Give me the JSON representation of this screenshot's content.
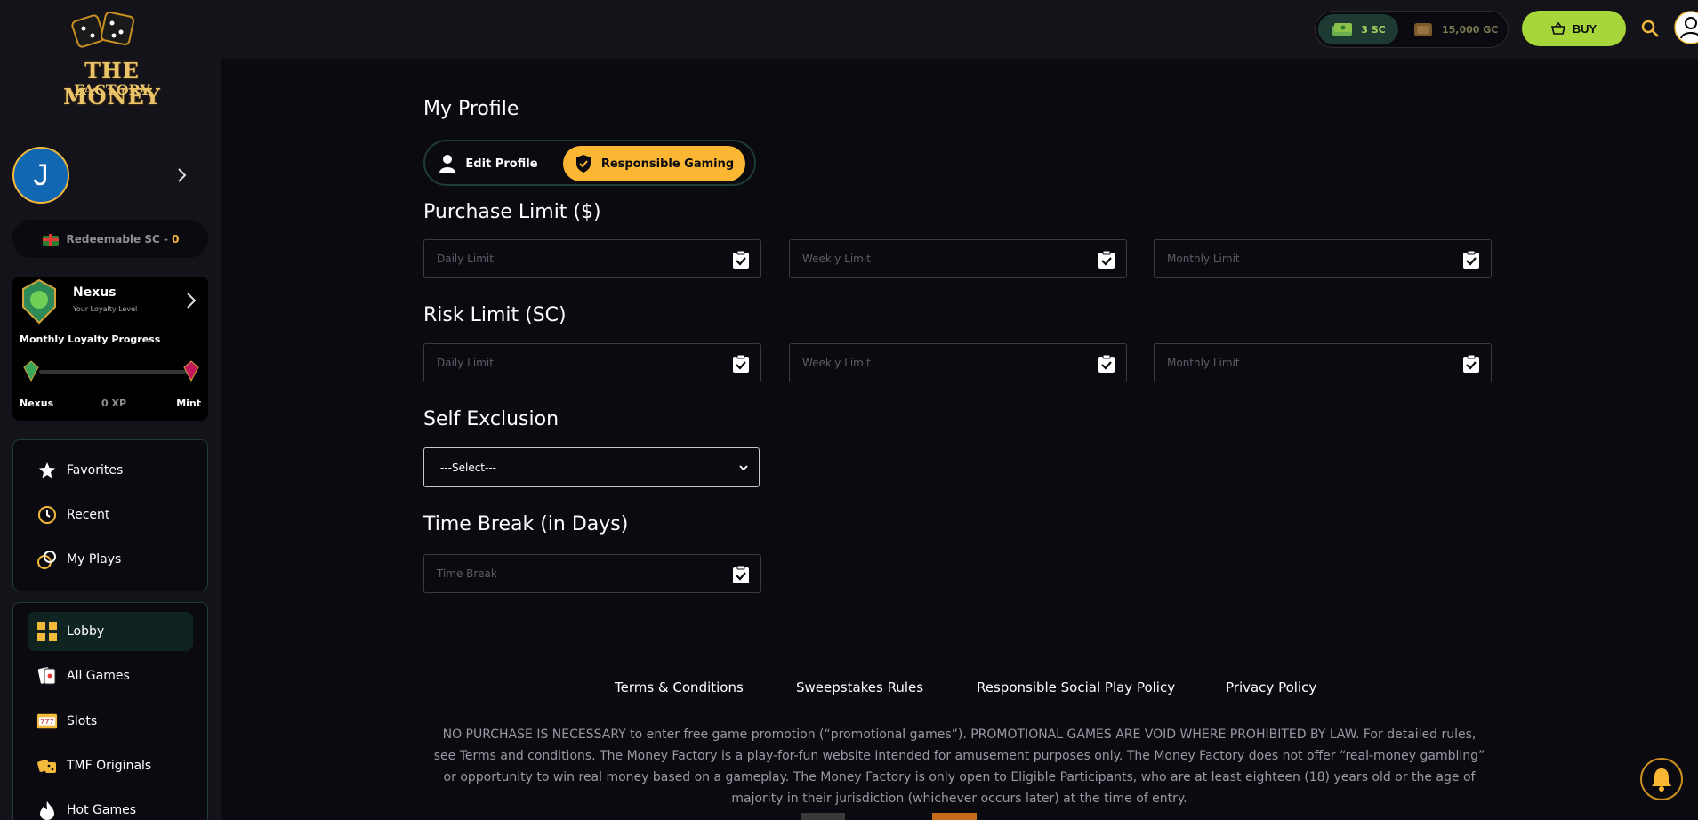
{
  "brand": {
    "logo_line1": "THE MONEY",
    "logo_line2": "FACTORY"
  },
  "user": {
    "initial": "J"
  },
  "redeemable": {
    "label": "Redeemable SC - ",
    "value": "0"
  },
  "loyalty": {
    "level": "Nexus",
    "subtitle": "Your Loyalty Level",
    "progress_title": "Monthly Loyalty Progress",
    "from": "Nexus",
    "xp": "0 XP",
    "to": "Mint",
    "progress": 0
  },
  "menu_primary": [
    {
      "label": "Favorites",
      "icon": "star-icon"
    },
    {
      "label": "Recent",
      "icon": "clock-icon"
    },
    {
      "label": "My Plays",
      "icon": "chips-icon"
    }
  ],
  "menu_games": [
    {
      "label": "Lobby",
      "icon": "grid-icon",
      "active": true
    },
    {
      "label": "All Games",
      "icon": "cards-icon"
    },
    {
      "label": "Slots",
      "icon": "slots-777-icon"
    },
    {
      "label": "TMF Originals",
      "icon": "dice-icon"
    },
    {
      "label": "Hot Games",
      "icon": "fire-icon"
    }
  ],
  "topbar": {
    "sc_balance": "3 SC",
    "gc_balance": "15,000 GC",
    "buy_label": "BUY"
  },
  "page": {
    "title": "My Profile",
    "tabs": [
      {
        "label": "Edit Profile",
        "active": false
      },
      {
        "label": "Responsible Gaming",
        "active": true
      }
    ],
    "purchase_limit": {
      "title": "Purchase Limit ($)",
      "fields": [
        "Daily Limit",
        "Weekly Limit",
        "Monthly Limit"
      ]
    },
    "risk_limit": {
      "title": "Risk Limit (SC)",
      "fields": [
        "Daily Limit",
        "Weekly Limit",
        "Monthly Limit"
      ]
    },
    "self_exclusion": {
      "title": "Self Exclusion",
      "selected": "---Select---"
    },
    "time_break": {
      "title": "Time Break (in Days)",
      "placeholder": "Time Break"
    }
  },
  "footer": {
    "links": [
      "Terms & Conditions",
      "Sweepstakes Rules",
      "Responsible Social Play Policy",
      "Privacy Policy"
    ],
    "disclaimer": "NO PURCHASE IS NECESSARY to enter free game promotion (“promotional games”). PROMOTIONAL GAMES ARE VOID WHERE PROHIBITED BY LAW. For detailed rules, see Terms and conditions. The Money Factory is a play-for-fun website intended for amusement purposes only. The Money Factory does not offer “real-money gambling” or opportunity to win real money based on a gameplay. The Money Factory is only open to Eligible Participants, who are at least eighteen (18) years old or the age of majority in their jurisdiction (whichever occurs later) at the time of entry."
  }
}
